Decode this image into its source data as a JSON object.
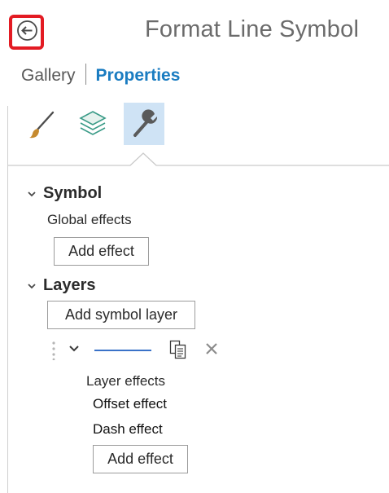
{
  "header": {
    "title": "Format Line Symbol",
    "back_icon": "arrow-left-circle-icon",
    "highlight_color": "#e31b23"
  },
  "tabs": {
    "gallery": "Gallery",
    "properties": "Properties",
    "active": "Properties",
    "active_color": "#1a7cc1"
  },
  "toolbar": {
    "icons": [
      "paintbrush-icon",
      "layers-icon",
      "wrench-icon"
    ],
    "selected": "wrench-icon"
  },
  "symbol": {
    "heading": "Symbol",
    "global_effects_label": "Global effects",
    "add_effect_label": "Add effect"
  },
  "layers": {
    "heading": "Layers",
    "add_symbol_layer_label": "Add symbol layer",
    "layer": {
      "line_color": "#3a72c8",
      "effects_label": "Layer effects",
      "effects": [
        "Offset effect",
        "Dash effect"
      ],
      "add_effect_label": "Add effect"
    }
  }
}
